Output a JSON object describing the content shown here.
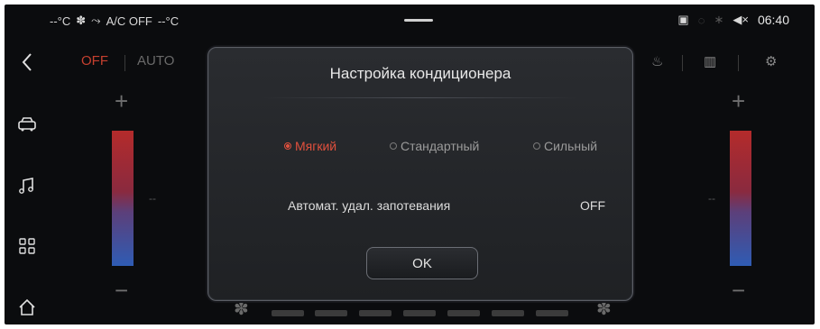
{
  "status_bar": {
    "left_temp": "--°C",
    "ac_text": "A/C OFF",
    "right_temp": "--°C",
    "time": "06:40"
  },
  "nav": {
    "items": [
      "back-icon",
      "car-icon",
      "music-icon",
      "apps-icon",
      "home-icon"
    ]
  },
  "controls": {
    "off_label": "OFF",
    "auto_label": "AUTO"
  },
  "temperature": {
    "left_value": "--",
    "right_value": "--"
  },
  "fan": {
    "segments": 7
  },
  "dialog": {
    "title": "Настройка кондиционера",
    "options": [
      {
        "label": "Мягкий",
        "selected": true
      },
      {
        "label": "Стандартный",
        "selected": false
      },
      {
        "label": "Сильный",
        "selected": false
      }
    ],
    "defog_label": "Автомат. удал. запотевания",
    "defog_value": "OFF",
    "ok_label": "OK"
  },
  "colors": {
    "accent": "#e0503d",
    "background": "#0b0c0e"
  }
}
